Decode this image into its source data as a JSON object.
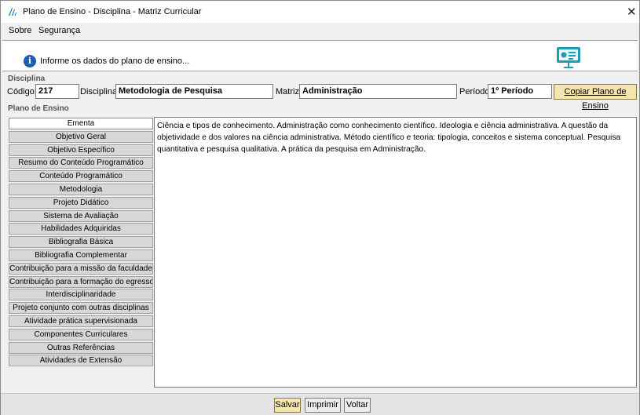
{
  "window": {
    "title": "Plano de Ensino - Disciplina - Matriz Curricular",
    "close_glyph": "✕"
  },
  "menu": {
    "items": [
      {
        "label": "Sobre"
      },
      {
        "label": "Segurança"
      }
    ]
  },
  "info": {
    "icon": "info-icon",
    "text": "Informe os dados do plano de ensino..."
  },
  "disciplina": {
    "group_label": "Disciplina",
    "codigo_label": "Código:",
    "codigo_value": "217",
    "disciplina_label": "Disciplina:",
    "disciplina_value": "Metodologia de Pesquisa",
    "matriz_label": "Matriz:",
    "matriz_value": "Administração",
    "periodo_label": "Período:",
    "periodo_value": "1º Período",
    "copy_button": "Copiar Plano de Ensino"
  },
  "plano": {
    "group_label": "Plano de Ensino",
    "tabs": [
      {
        "label": "Ementa",
        "active": true
      },
      {
        "label": "Objetivo Geral"
      },
      {
        "label": "Objetivo Específico"
      },
      {
        "label": "Resumo do Conteúdo Programático"
      },
      {
        "label": "Conteúdo Programático"
      },
      {
        "label": "Metodologia"
      },
      {
        "label": "Projeto Didático"
      },
      {
        "label": "Sistema de Avaliação"
      },
      {
        "label": "Habilidades Adquiridas"
      },
      {
        "label": "Bibliografia Básica"
      },
      {
        "label": "Bibliografia Complementar"
      },
      {
        "label": "Contribuição para a missão da faculdade"
      },
      {
        "label": "Contribuição para a formação do egresso"
      },
      {
        "label": "Interdisciplinaridade"
      },
      {
        "label": "Projeto conjunto com outras disciplinas"
      },
      {
        "label": "Atividade prática supervisionada"
      },
      {
        "label": "Componentes Curriculares"
      },
      {
        "label": "Outras Referências"
      },
      {
        "label": "Atividades de Extensão"
      }
    ],
    "content": "Ciência e tipos de conhecimento. Administração como conhecimento científico. Ideologia e ciência administrativa. A questão da objetividade e dos valores na ciência administrativa. Método científico e teoria: tipologia, conceitos e sistema conceptual. Pesquisa quantitativa e pesquisa qualitativa. A prática da pesquisa em Administração."
  },
  "footer": {
    "save": "Salvar",
    "print": "Imprimir",
    "back": "Voltar"
  }
}
